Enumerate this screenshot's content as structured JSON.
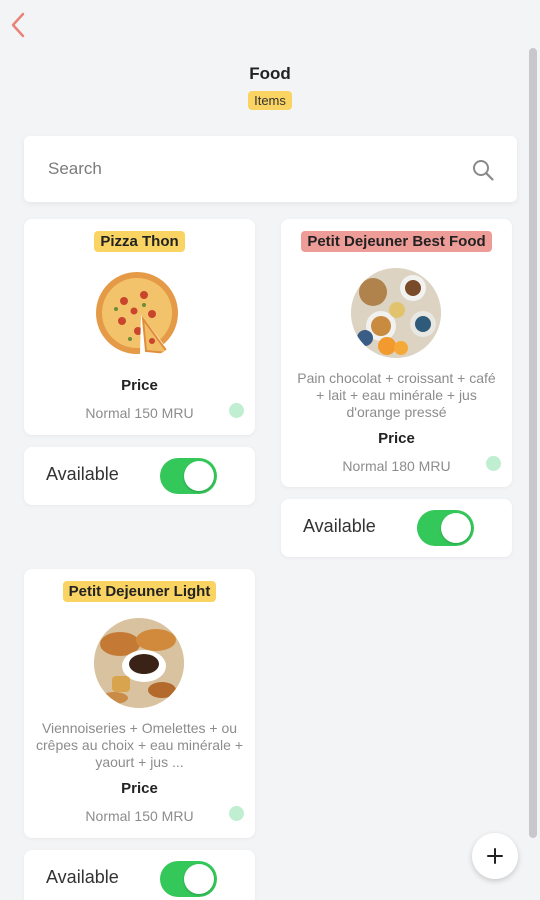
{
  "header": {
    "title": "Food",
    "subtitle": "Items"
  },
  "search": {
    "placeholder": "Search",
    "value": ""
  },
  "items": [
    {
      "name": "Pizza Thon",
      "badge_color": "#f9d463",
      "description": "",
      "price_label": "Price",
      "price_value": "Normal 150 MRU",
      "available_label": "Available",
      "available": true
    },
    {
      "name": "Petit Dejeuner Best Food",
      "badge_color": "#ee9c98",
      "description": "Pain chocolat + croissant + café + lait + eau minérale + jus d'orange pressé",
      "price_label": "Price",
      "price_value": "Normal 180 MRU",
      "available_label": "Available",
      "available": true
    },
    {
      "name": "Petit Dejeuner Light",
      "badge_color": "#f9d463",
      "description": "Viennoiseries + Omelettes + ou crêpes au choix + eau minérale + yaourt + jus ...",
      "price_label": "Price",
      "price_value": "Normal 150 MRU",
      "available_label": "Available",
      "available": true
    }
  ],
  "colors": {
    "accent_toggle": "#34c759",
    "back_arrow": "#e8837a",
    "status_dot": "#bfeed0"
  },
  "icons": {
    "back": "chevron-left-icon",
    "search": "search-icon",
    "add": "plus-icon"
  }
}
